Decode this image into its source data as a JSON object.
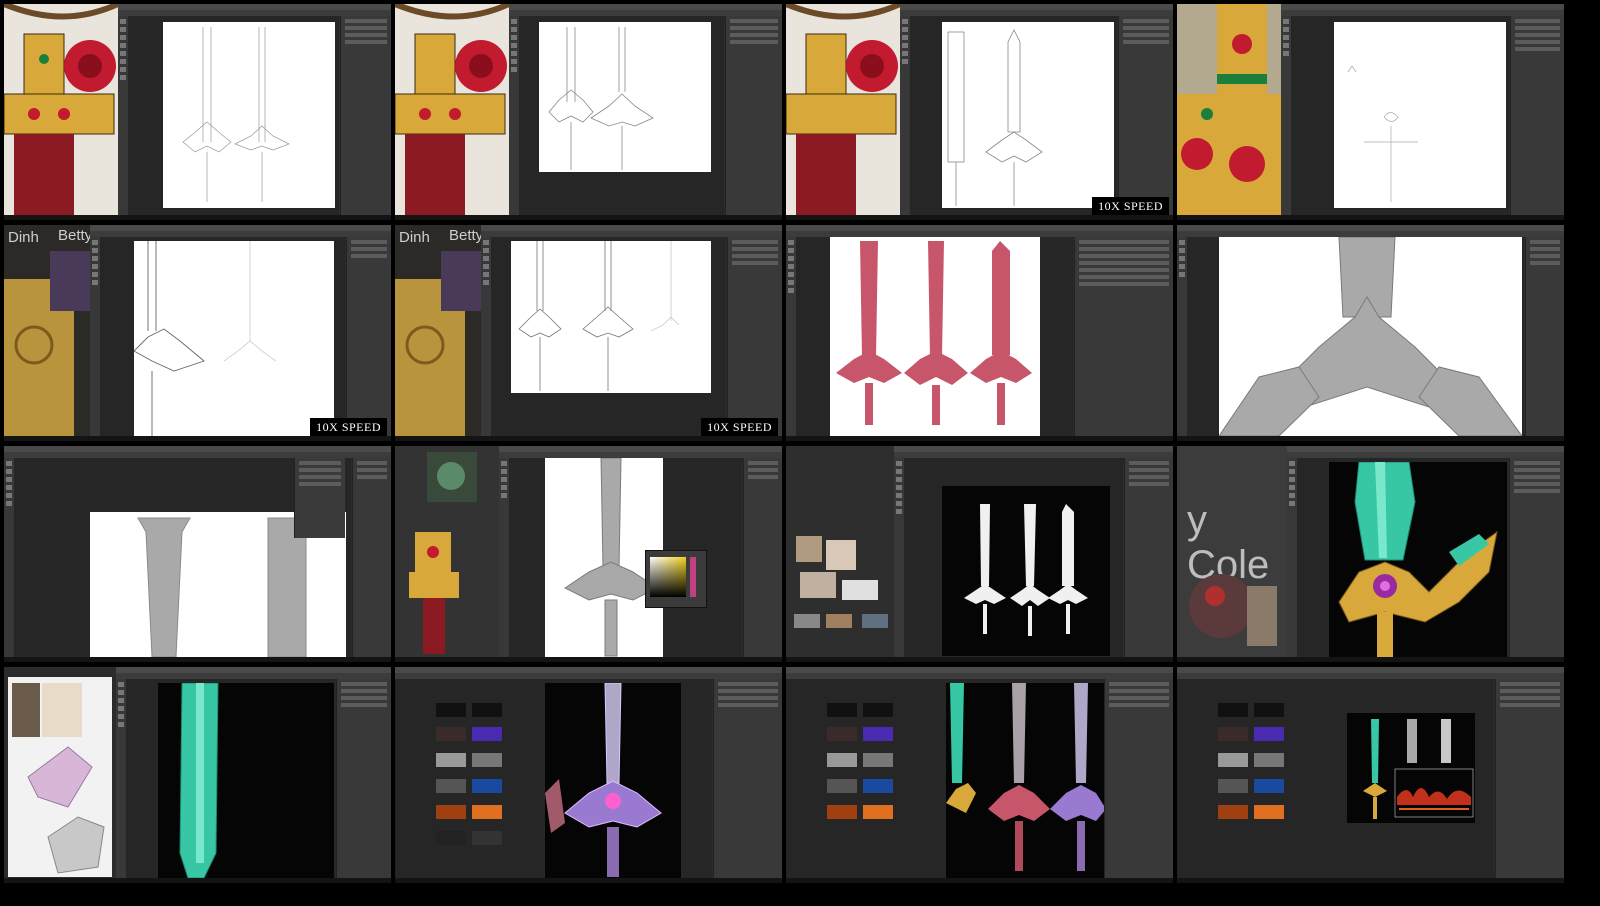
{
  "grid": {
    "rows": 4,
    "cols": 4
  },
  "badges": {
    "t2": "10X SPEED",
    "t4": "10X SPEED",
    "t5": "10X SPEED"
  },
  "reference_labels": {
    "t4_left": "Dinh",
    "t4_right": "Betty",
    "t5_left": "Dinh",
    "t5_right": "Betty",
    "t11_text": "y Cole"
  },
  "colors": {
    "frame": "#000000",
    "desktop": "#5a1218",
    "ps_bg": "#2b2b2b",
    "ps_panel": "#393939",
    "sword_pink": "#c8566a",
    "sword_gray": "#a9a9a9",
    "sword_teal": "#37c7a4",
    "gold": "#d8a93a",
    "rose_red": "#c21a2e",
    "badge_bg": "#000000",
    "badge_text": "#ffffff"
  }
}
